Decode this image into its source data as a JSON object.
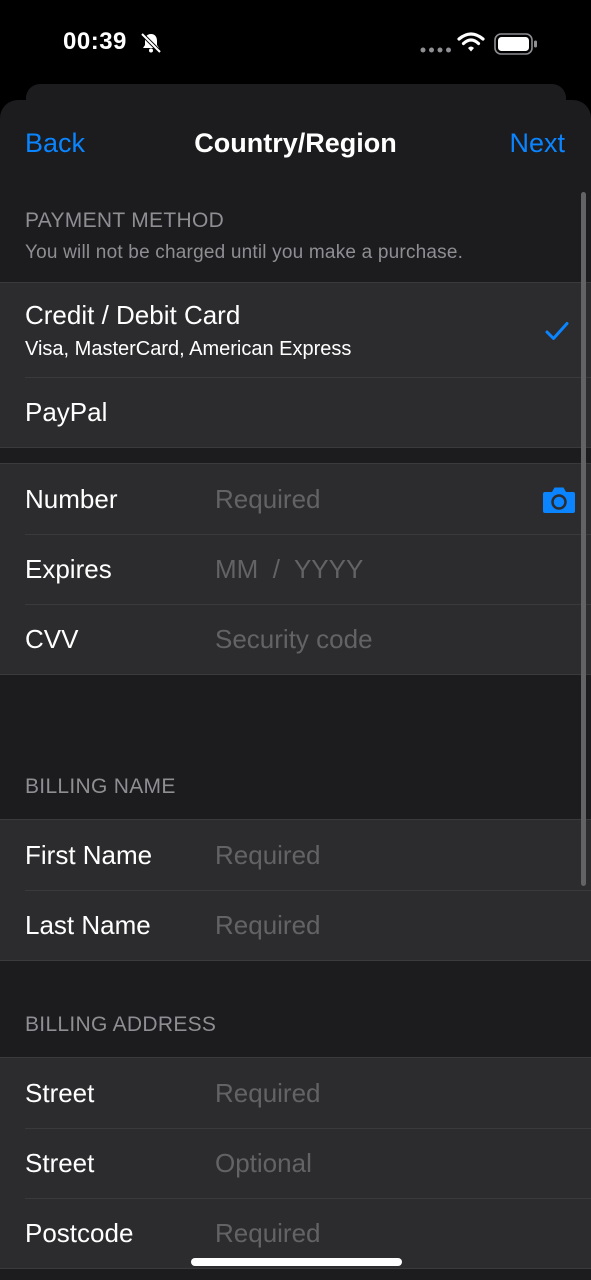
{
  "status_bar": {
    "time": "00:39"
  },
  "nav": {
    "back": "Back",
    "title": "Country/Region",
    "next": "Next"
  },
  "payment_method": {
    "header": "PAYMENT METHOD",
    "subheader": "You will not be charged until you make a purchase.",
    "options": [
      {
        "title": "Credit / Debit Card",
        "subtitle": "Visa, MasterCard, American Express",
        "selected": true
      },
      {
        "title": "PayPal",
        "selected": false
      }
    ]
  },
  "card": {
    "number_label": "Number",
    "number_placeholder": "Required",
    "expires_label": "Expires",
    "expires_placeholder": "MM  /  YYYY",
    "cvv_label": "CVV",
    "cvv_placeholder": "Security code"
  },
  "billing_name": {
    "header": "BILLING NAME",
    "first_label": "First Name",
    "first_placeholder": "Required",
    "last_label": "Last Name",
    "last_placeholder": "Required"
  },
  "billing_address": {
    "header": "BILLING ADDRESS",
    "street1_label": "Street",
    "street1_placeholder": "Required",
    "street2_label": "Street",
    "street2_placeholder": "Optional",
    "postcode_label": "Postcode",
    "postcode_placeholder": "Required"
  },
  "icons": {
    "bell": "bell-slash-icon",
    "signal": "cellular-dots-icon",
    "wifi": "wifi-icon",
    "battery": "battery-icon",
    "check": "checkmark-icon",
    "camera": "camera-icon"
  },
  "colors": {
    "accent": "#0a84ff",
    "sheet": "#1c1c1e",
    "cell": "#2c2c2e",
    "separator": "#3a3a3c",
    "placeholder": "#636366",
    "secondary": "#8e8e93"
  }
}
